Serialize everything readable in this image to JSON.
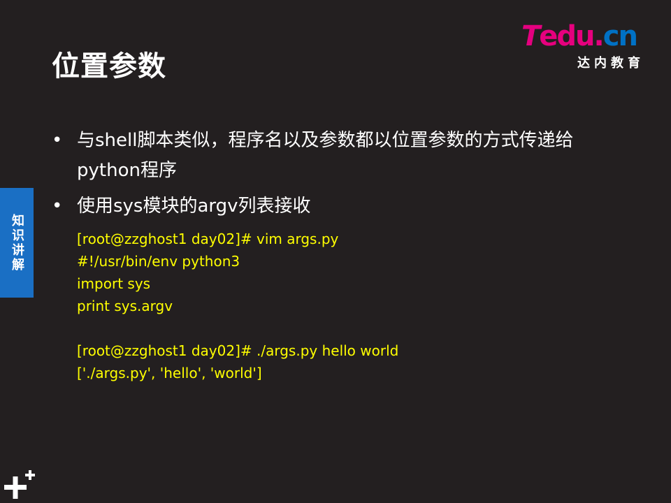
{
  "slide": {
    "title": "位置参数",
    "side_tab": "知识讲解"
  },
  "logo": {
    "letter_t": "T",
    "word": "edu.",
    "suffix": "cn",
    "subtitle": "达内教育"
  },
  "bullets": [
    {
      "dot": "•",
      "text": "与shell脚本类似，程序名以及参数都以位置参数的方式传递给python程序"
    },
    {
      "dot": "•",
      "text": "使用sys模块的argv列表接收"
    }
  ],
  "code_lines": [
    "[root@zzghost1 day02]# vim args.py",
    "#!/usr/bin/env python3",
    "import sys",
    "print sys.argv",
    "",
    "[root@zzghost1 day02]# ./args.py hello world",
    "['./args.py', 'hello', 'world']"
  ],
  "icons": {
    "corner": "plus-icon"
  }
}
